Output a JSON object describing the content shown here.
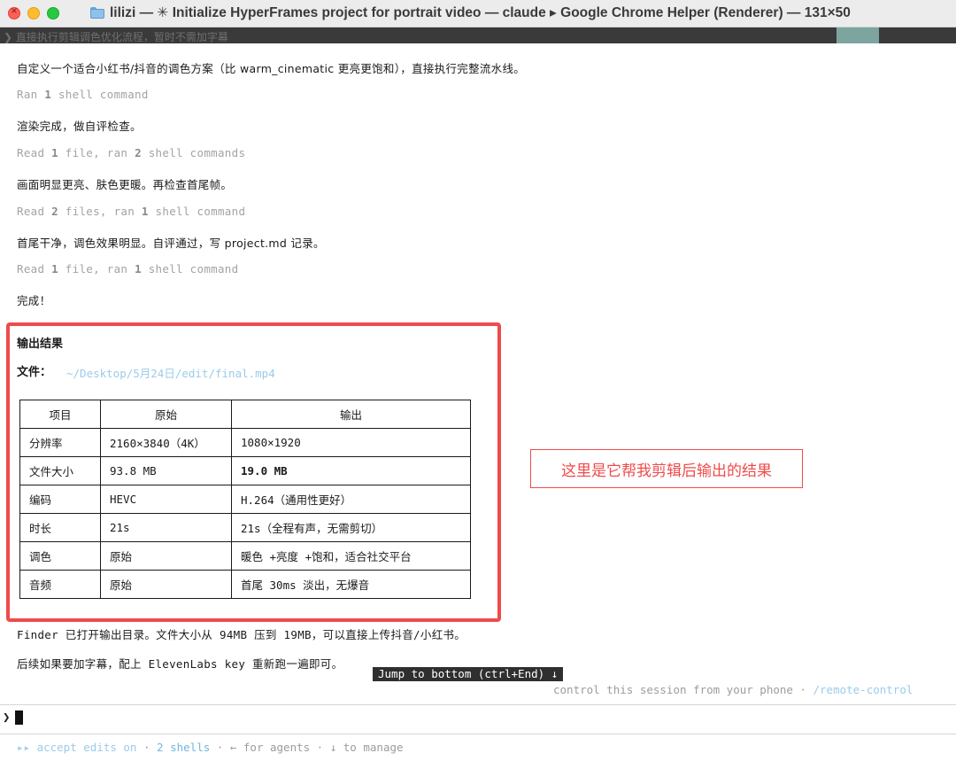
{
  "window": {
    "title": "lilizi — ✳ Initialize HyperFrames project for portrait video — claude ▸ Google Chrome Helper (Renderer) — 131×50",
    "close_glyph": "×"
  },
  "top_strip": {
    "text": "❯ 直接执行剪辑调色优化流程，暂时不需加字幕"
  },
  "transcript": {
    "l1": "自定义一个适合小红书/抖音的调色方案（比 warm_cinematic 更亮更饱和），直接执行完整流水线。",
    "l2": {
      "pre": "Ran ",
      "n1": "1",
      "post": " shell command"
    },
    "l3": "渲染完成，做自评检查。",
    "l4": {
      "pre": "Read ",
      "n1": "1",
      "mid": " file, ran ",
      "n2": "2",
      "post": " shell commands"
    },
    "l5": "画面明显更亮、肤色更暖。再检查首尾帧。",
    "l6": {
      "pre": "Read ",
      "n1": "2",
      "mid": " files, ran ",
      "n2": "1",
      "post": " shell command"
    },
    "l7": "首尾干净，调色效果明显。自评通过，写 project.md 记录。",
    "l8": {
      "pre": "Read ",
      "n1": "1",
      "mid": " file, ran ",
      "n2": "1",
      "post": " shell command"
    },
    "l9": "完成！"
  },
  "output": {
    "title": "输出结果",
    "file_label": "文件：",
    "file_path": "~/Desktop/5月24日/edit/final.mp4",
    "table": {
      "headers": [
        "项目",
        "原始",
        "输出"
      ],
      "rows": [
        [
          "分辨率",
          "2160×3840（4K）",
          "1080×1920"
        ],
        [
          "文件大小",
          "93.8 MB",
          "19.0 MB"
        ],
        [
          "编码",
          "HEVC",
          "H.264（通用性更好）"
        ],
        [
          "时长",
          "21s",
          "21s（全程有声，无需剪切）"
        ],
        [
          "调色",
          "原始",
          "暖色 +亮度 +饱和，适合社交平台"
        ],
        [
          "音频",
          "原始",
          "首尾 30ms 淡出，无爆音"
        ]
      ]
    }
  },
  "after": {
    "l1": "Finder 已打开输出目录。文件大小从 94MB 压到 19MB，可以直接上传抖音/小红书。",
    "l2": "后续如果要加字幕，配上 ElevenLabs key 重新跑一遍即可。"
  },
  "annotation": "这里是它帮我剪辑后输出的结果",
  "jump_label": "Jump to bottom (ctrl+End) ↓",
  "remote": {
    "text": "control this session from your phone · ",
    "link": "/remote-control"
  },
  "prompt_symbol": "❯",
  "footer": {
    "arrows": "▸▸ accept edits on",
    "sep1": " · ",
    "shells": "2 shells",
    "sep2": " · ",
    "agents": "← for agents",
    "sep3": " · ",
    "manage": "↓ to manage"
  }
}
